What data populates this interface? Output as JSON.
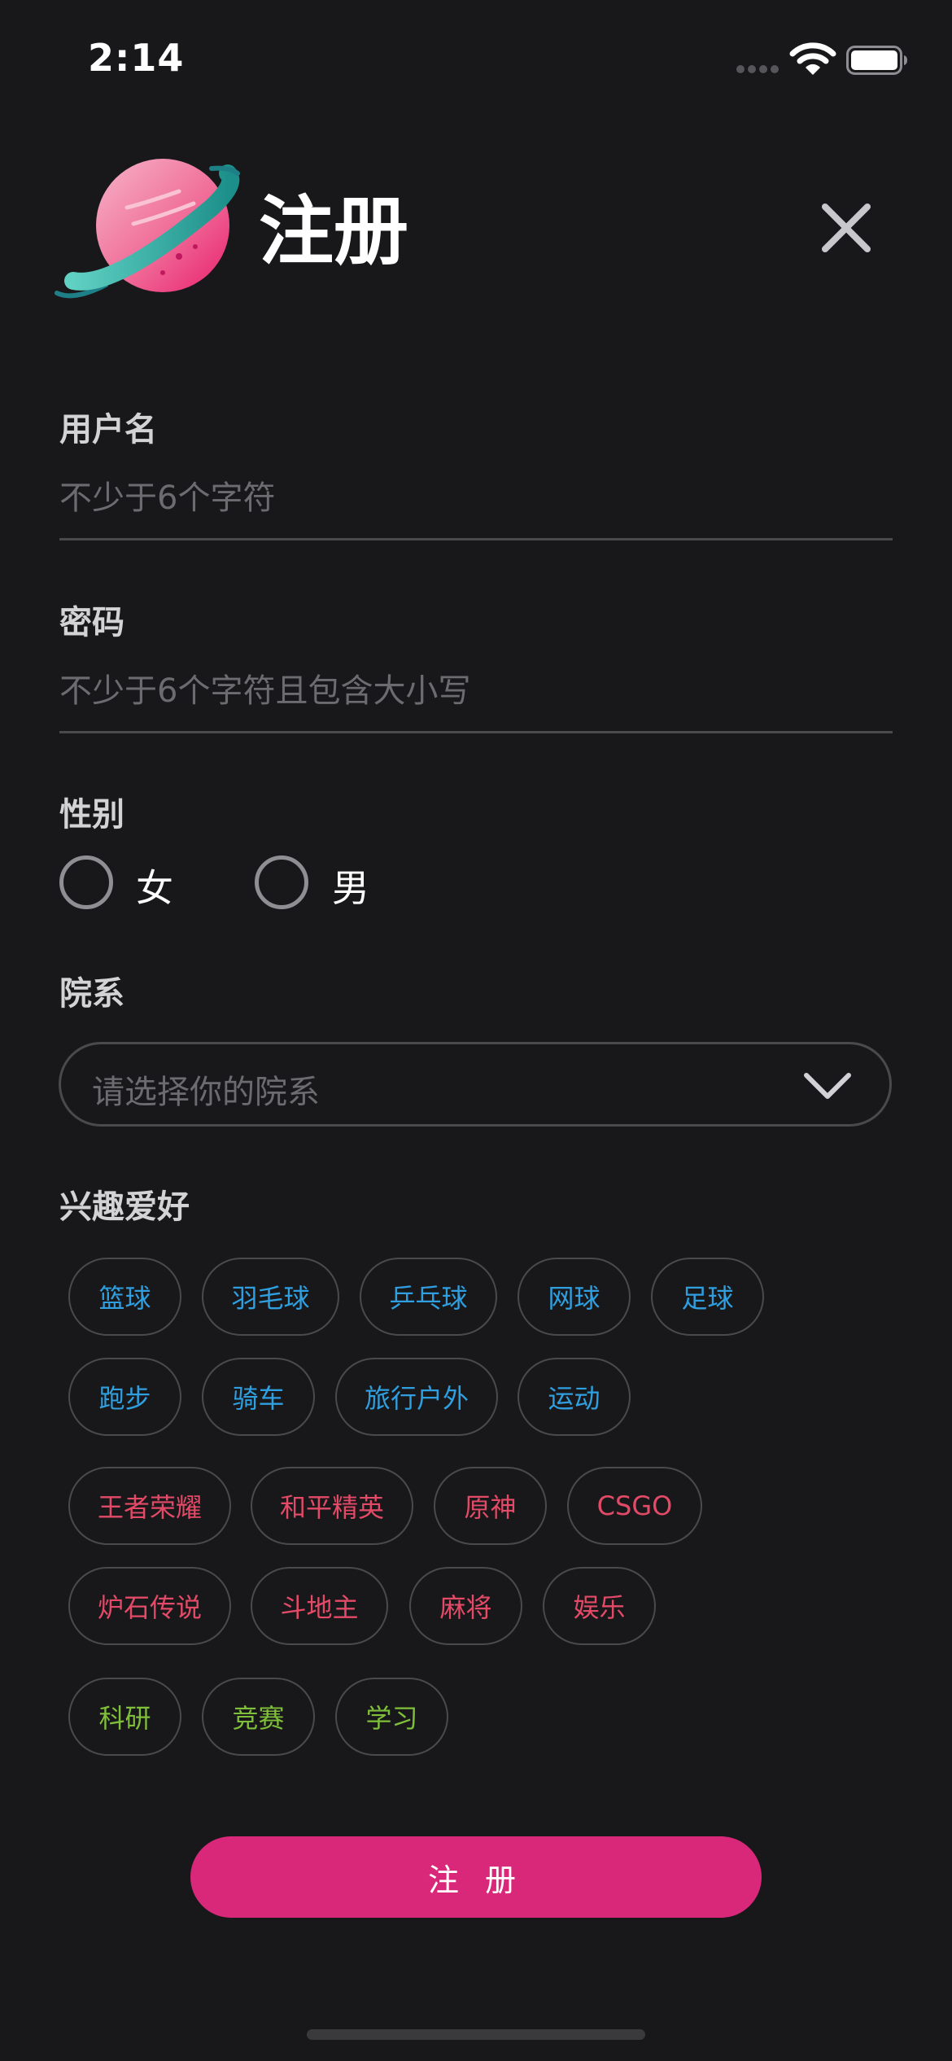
{
  "status_bar": {
    "time": "2:14"
  },
  "header": {
    "title": "注册"
  },
  "form": {
    "username": {
      "label": "用户名",
      "placeholder": "不少于6个字符"
    },
    "password": {
      "label": "密码",
      "placeholder": "不少于6个字符且包含大小写"
    },
    "gender": {
      "label": "性别",
      "options": [
        "女",
        "男"
      ]
    },
    "department": {
      "label": "院系",
      "placeholder": "请选择你的院系"
    },
    "interests": {
      "label": "兴趣爱好",
      "sports": [
        "篮球",
        "羽毛球",
        "乒乓球",
        "网球",
        "足球",
        "跑步",
        "骑车",
        "旅行户外",
        "运动"
      ],
      "games": [
        "王者荣耀",
        "和平精英",
        "原神",
        "CSGO",
        "炉石传说",
        "斗地主",
        "麻将",
        "娱乐"
      ],
      "study": [
        "科研",
        "竞赛",
        "学习"
      ]
    },
    "submit_label": "注 册"
  },
  "colors": {
    "background": "#18181a",
    "sports_tag": "#2f9fe0",
    "games_tag": "#e34a67",
    "study_tag": "#7fbf3a",
    "submit": "#d9287a"
  }
}
